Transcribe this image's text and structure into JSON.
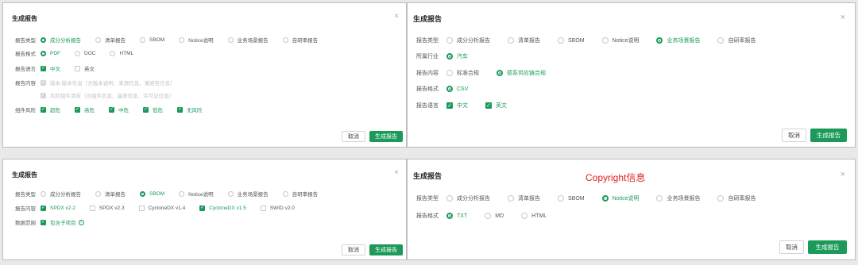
{
  "colors": {
    "accent": "#1b9a5a",
    "note": "#e02020"
  },
  "icons": {
    "close": "close-icon",
    "info": "info-icon",
    "check": "checkmark-icon"
  },
  "common": {
    "dialog_title": "生成报告",
    "close_symbol": "×",
    "cancel_label": "取消",
    "generate_label": "生成报告"
  },
  "d1": {
    "type_label": "报告类型",
    "types": [
      "成分分析报告",
      "清单报告",
      "SBOM",
      "Notice说明",
      "业务场景报告",
      "自研率报告"
    ],
    "format_label": "报告格式",
    "formats": [
      "PDF",
      "DOC",
      "HTML"
    ],
    "lang_label": "报告语言",
    "langs": [
      "中文",
      "英文"
    ],
    "content_label": "报告内容",
    "content_items": [
      "版本:版本信息（含版本说明、来源信息、兼容性信息）",
      "风险组件清单（含组件信息、漏洞信息、许可证信息）"
    ],
    "risk_label": "组件风险",
    "risks": [
      "超危",
      "高危",
      "中危",
      "低危",
      "无风险"
    ]
  },
  "d2": {
    "type_label": "报告类型",
    "types": [
      "成分分析报告",
      "清单报告",
      "SBOM",
      "Notice说明",
      "业务场景报告",
      "自研率报告"
    ],
    "industry_label": "所属行业",
    "industries": [
      "汽车"
    ],
    "content_label": "报告内容",
    "contents": [
      "标准合规",
      "德系供应链合规"
    ],
    "format_label": "报告格式",
    "formats": [
      "CSV"
    ],
    "lang_label": "报告语言",
    "langs": [
      "中文",
      "英文"
    ]
  },
  "d3": {
    "type_label": "报告类型",
    "types": [
      "成分分析报告",
      "清单报告",
      "SBOM",
      "Notice说明",
      "业务场景报告",
      "自研率报告"
    ],
    "content_label": "报告内容",
    "contents": [
      "SPDX v2.2",
      "SPDX v2.3",
      "CycloneDX v1.4",
      "CycloneDX v1.5",
      "SWID v2.0"
    ],
    "scope_label": "数据范围",
    "scope_option": "包含子项目",
    "info_symbol": "i"
  },
  "d4": {
    "type_label": "报告类型",
    "types": [
      "成分分析报告",
      "清单报告",
      "SBOM",
      "Notice说明",
      "业务场景报告",
      "自研率报告"
    ],
    "format_label": "报告格式",
    "formats": [
      "TXT",
      "MD",
      "HTML"
    ],
    "note": "Copyright信息"
  }
}
